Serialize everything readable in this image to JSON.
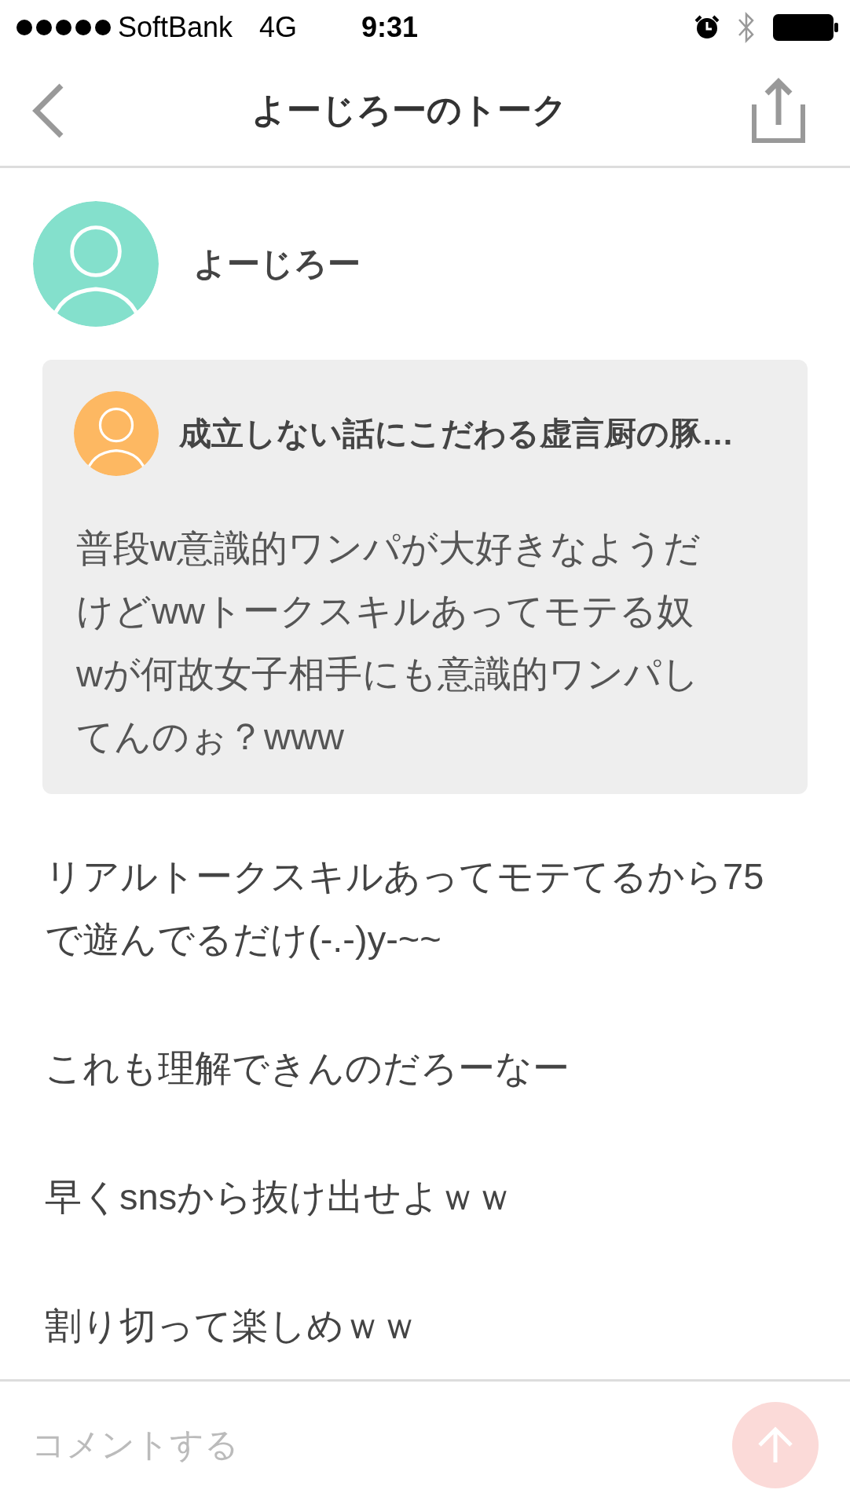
{
  "status_bar": {
    "carrier": "SoftBank",
    "network": "4G",
    "time": "9:31"
  },
  "header": {
    "title": "よーじろーのトーク"
  },
  "author": {
    "name": "よーじろー"
  },
  "quote": {
    "author": "成立しない話にこだわる虚言厨の豚…",
    "text": "普段w意識的ワンパが大好きなようだけどwwトークスキルあってモテる奴wが何故女子相手にも意識的ワンパしてんのぉ？www"
  },
  "replies": [
    "リアルトークスキルあってモテてるから75で遊んでるだけ(-.-)y-~~",
    "これも理解できんのだろーなー",
    "早くsnsから抜け出せよｗｗ",
    "割り切って楽しめｗｗ"
  ],
  "comment": {
    "placeholder": "コメントする",
    "send_disabled": true
  }
}
